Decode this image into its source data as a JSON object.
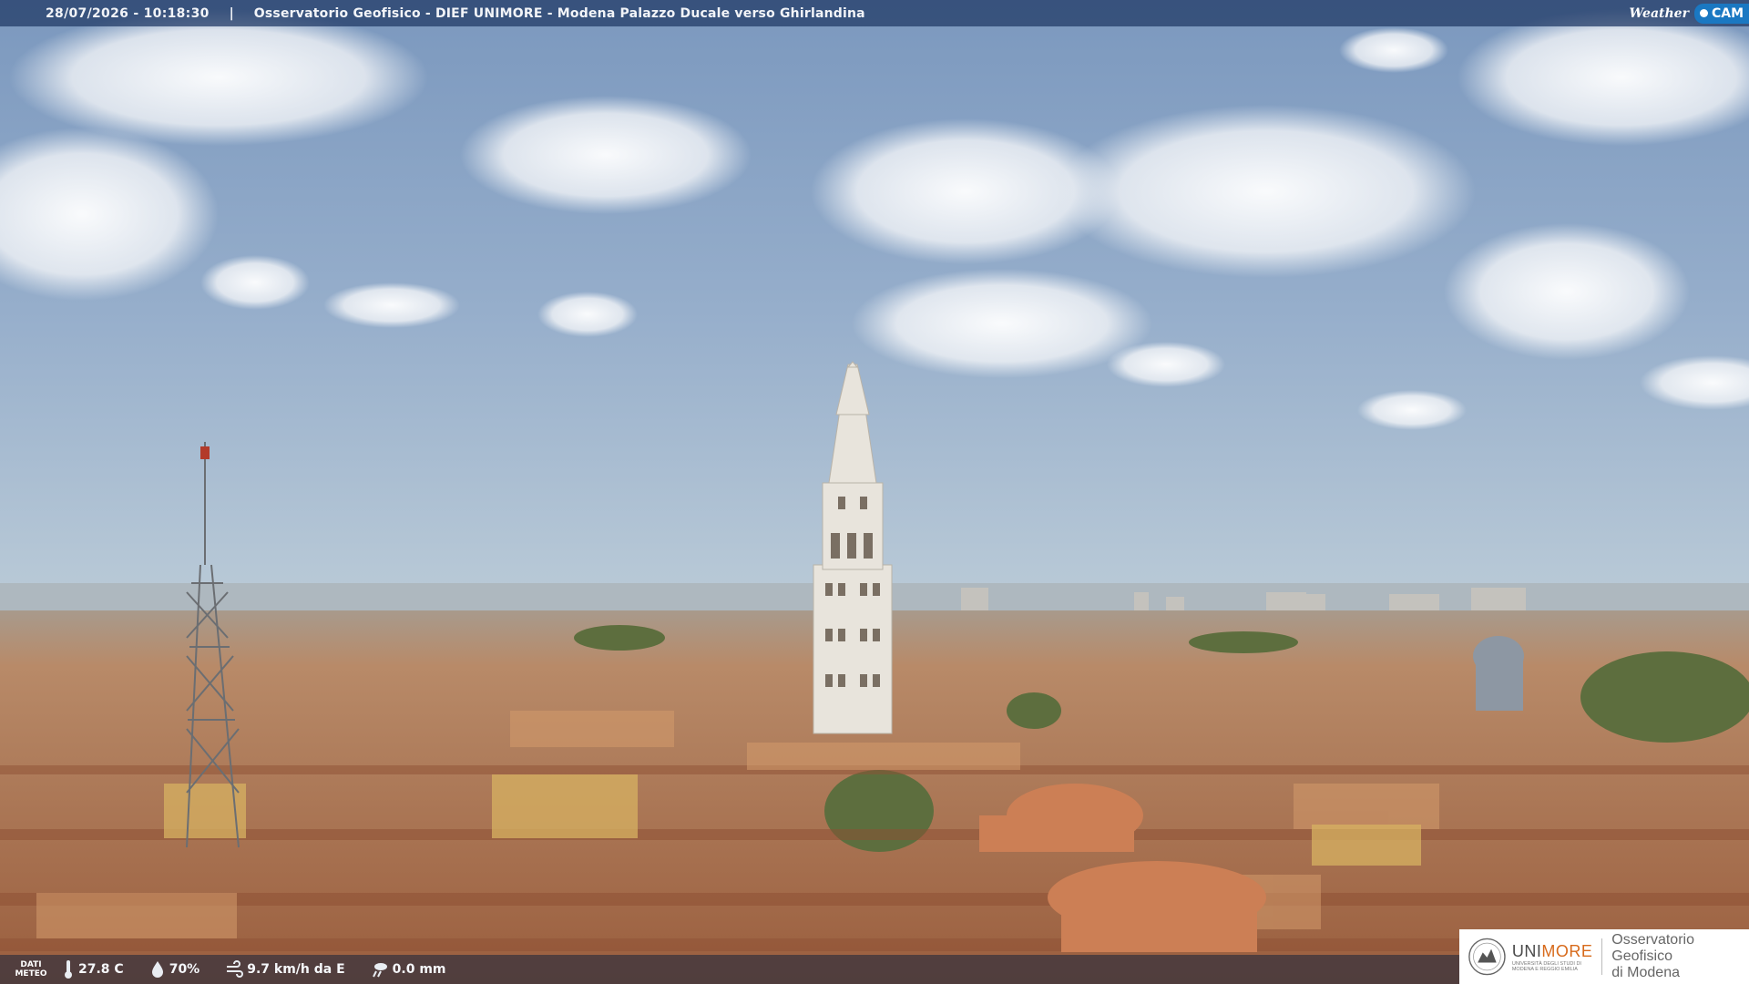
{
  "header": {
    "timestamp": "28/07/2026 - 10:18:30",
    "separator": "|",
    "title": "Osservatorio Geofisico - DIEF UNIMORE - Modena Palazzo Ducale verso Ghirlandina"
  },
  "brand": {
    "weather_word": "Weather",
    "cam_word": "CAM"
  },
  "meteo": {
    "label_line1": "DATI",
    "label_line2": "METEO",
    "temperature": "27.8 C",
    "humidity": "70%",
    "wind": "9.7 km/h da E",
    "rain": "0.0 mm"
  },
  "logo": {
    "uni_part1": "UNI",
    "uni_part2": "MORE",
    "uni_sub1": "UNIVERSITÀ DEGLI STUDI DI",
    "uni_sub2": "MODENA E REGGIO EMILIA",
    "obs_line1": "Osservatorio Geofisico",
    "obs_line2": "di Modena"
  },
  "icons": {
    "temperature": "thermometer-icon",
    "humidity": "droplet-icon",
    "wind": "wind-icon",
    "rain": "rain-icon"
  },
  "colors": {
    "sky_top": "#7f9cc0",
    "sky_horizon": "#b7c8d6",
    "roofs": "#b07a58",
    "tower": "#e6e2da",
    "header_bar": "#1e3764",
    "unimore_orange": "#d76a1b",
    "cam_blue": "#1a78c2"
  }
}
